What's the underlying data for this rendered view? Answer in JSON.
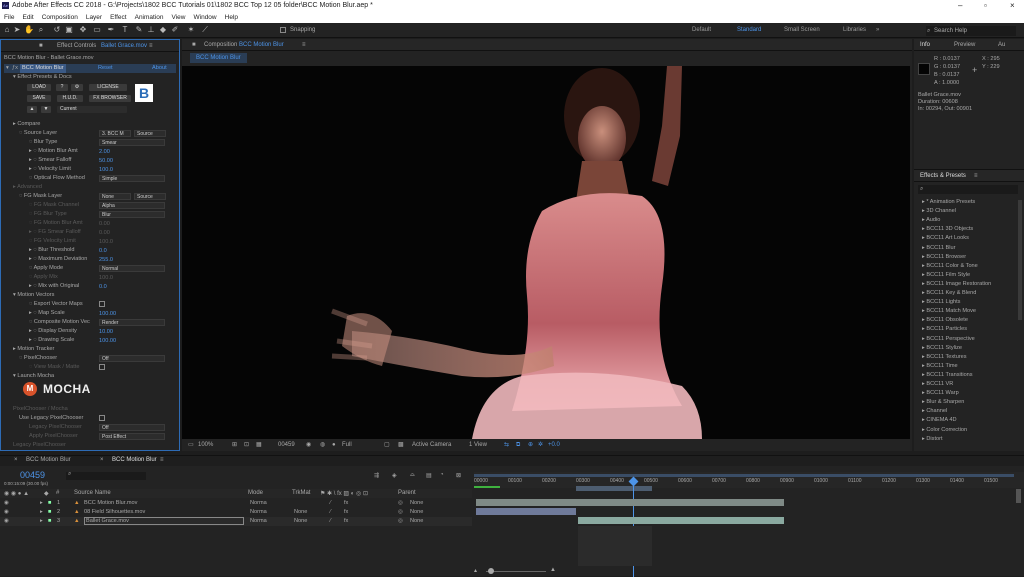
{
  "window": {
    "title": "Adobe After Effects CC 2018 - G:\\Projects\\1802 BCC Tutorials 01\\1802 BCC Top 12 05 folder\\BCC Motion Blur.aep *"
  },
  "menu": [
    "File",
    "Edit",
    "Composition",
    "Layer",
    "Effect",
    "Animation",
    "View",
    "Window",
    "Help"
  ],
  "toolbar": {
    "snapping": "Snapping",
    "workspaces": [
      "Default",
      "Standard",
      "Small Screen",
      "Libraries"
    ],
    "search_placeholder": "Search Help"
  },
  "effect_controls": {
    "tab": "Effect Controls",
    "tab_layer": "Ballet Grace.mov",
    "subtitle": "BCC Motion Blur - Ballet Grace.mov",
    "effect_name": "BCC Motion Blur",
    "reset": "Reset",
    "about": "About",
    "presets": "Effect Presets & Docs",
    "buttons": [
      "LOAD",
      "?",
      "LICENSE",
      "SAVE",
      "H.U.D.",
      "FX BROWSER"
    ],
    "current": "Current",
    "rows": [
      {
        "label": "Compare",
        "value": ""
      },
      {
        "label": "Source Layer",
        "value": "3. BCC M",
        "value2": "Source"
      },
      {
        "label": "Blur Type",
        "value": "Smear"
      },
      {
        "label": "Motion Blur Amt",
        "value": "2.00"
      },
      {
        "label": "Smear Falloff",
        "value": "50.00"
      },
      {
        "label": "Velocity Limit",
        "value": "100.0"
      },
      {
        "label": "Optical Flow Method",
        "value": "Simple"
      },
      {
        "label": "Advanced",
        "value": ""
      },
      {
        "label": "FG Mask Layer",
        "value": "None",
        "value2": "Source"
      },
      {
        "label": "FG Mask Channel",
        "value": "Alpha"
      },
      {
        "label": "FG Blur Type",
        "value": "Blur"
      },
      {
        "label": "FG Motion Blur Amt",
        "value": "0.00"
      },
      {
        "label": "FG Smear Falloff",
        "value": "0.00"
      },
      {
        "label": "FG Velocity Limit",
        "value": "100.0"
      },
      {
        "label": "Blur Threshold",
        "value": "0.0"
      },
      {
        "label": "Maximum Deviation",
        "value": "255.0"
      },
      {
        "label": "Apply Mode",
        "value": "Normal"
      },
      {
        "label": "Apply Mix",
        "value": "100.0"
      },
      {
        "label": "Mix with Original",
        "value": "0.0"
      },
      {
        "label": "Motion Vectors",
        "value": ""
      },
      {
        "label": "Export Vector Maps",
        "value": ""
      },
      {
        "label": "Map Scale",
        "value": "100.00"
      },
      {
        "label": "Composite Motion Vec",
        "value": "Render"
      },
      {
        "label": "Display Density",
        "value": "10.00"
      },
      {
        "label": "Drawing Scale",
        "value": "100.00"
      },
      {
        "label": "Motion Tracker",
        "value": ""
      },
      {
        "label": "PixelChooser",
        "value": "Off"
      },
      {
        "label": "View Mask / Matte",
        "value": ""
      },
      {
        "label": "Launch Mocha",
        "value": ""
      }
    ],
    "mocha": "MOCHA",
    "rows2": [
      {
        "label": "PixelChooser / Mocha",
        "value": ""
      },
      {
        "label": "Use Legacy PixelChooser",
        "value": ""
      },
      {
        "label": "Legacy PixelChooser",
        "value": "Off"
      },
      {
        "label": "Apply PixelChooser",
        "value": "Post Effect"
      },
      {
        "label": "Legacy PixelChooser",
        "value": ""
      }
    ]
  },
  "composition": {
    "tab": "Composition",
    "name": "BCC Motion Blur",
    "crumb": "BCC Motion Blur",
    "footer": {
      "zoom": "100%",
      "timecode": "00459",
      "resolution": "Full",
      "camera": "Active Camera",
      "view": "1 View",
      "exposure": "+0.0"
    }
  },
  "info": {
    "tabs": [
      "Info",
      "Preview",
      "Au"
    ],
    "r": "0.0137",
    "g": "0.0137",
    "b": "0.0137",
    "a": "1.0000",
    "x": "X : 295",
    "y": "Y : 229",
    "clip": "Ballet Grace.mov",
    "duration": "Duration: 00608",
    "inout": "In: 00294, Out: 00901"
  },
  "effects_presets": {
    "title": "Effects & Presets",
    "items": [
      "* Animation Presets",
      "3D Channel",
      "Audio",
      "BCC11 3D Objects",
      "BCC11 Art Looks",
      "BCC11 Blur",
      "BCC11 Browser",
      "BCC11 Color & Tone",
      "BCC11 Film Style",
      "BCC11 Image Restoration",
      "BCC11 Key & Blend",
      "BCC11 Lights",
      "BCC11 Match Move",
      "BCC11 Obsolete",
      "BCC11 Particles",
      "BCC11 Perspective",
      "BCC11 Stylize",
      "BCC11 Textures",
      "BCC11 Time",
      "BCC11 Transitions",
      "BCC11 VR",
      "BCC11 Warp",
      "Blur & Sharpen",
      "Channel",
      "CINEMA 4D",
      "Color Correction",
      "Distort"
    ]
  },
  "timeline": {
    "tabs": [
      "BCC Motion Blur",
      "BCC Motion Blur"
    ],
    "timecode": "00459",
    "timecode_sub": "0:00:15:09 (30.00 fps)",
    "headers": [
      "Source Name",
      "Mode",
      "TrkMat",
      "Parent"
    ],
    "layers": [
      {
        "num": "1",
        "name": "BCC Motion Blur.mov",
        "mode": "Norma",
        "trk": "",
        "parent": "None"
      },
      {
        "num": "2",
        "name": "08 Field Silhouettes.mov",
        "mode": "Norma",
        "trk": "None",
        "parent": "None"
      },
      {
        "num": "3",
        "name": "Ballet Grace.mov",
        "mode": "Norma",
        "trk": "None",
        "parent": "None"
      }
    ],
    "ruler": [
      "00000",
      "00100",
      "00200",
      "00300",
      "00400",
      "00500",
      "00600",
      "00700",
      "00800",
      "00900",
      "01000",
      "01100",
      "01200",
      "01300",
      "01400",
      "01500"
    ]
  }
}
